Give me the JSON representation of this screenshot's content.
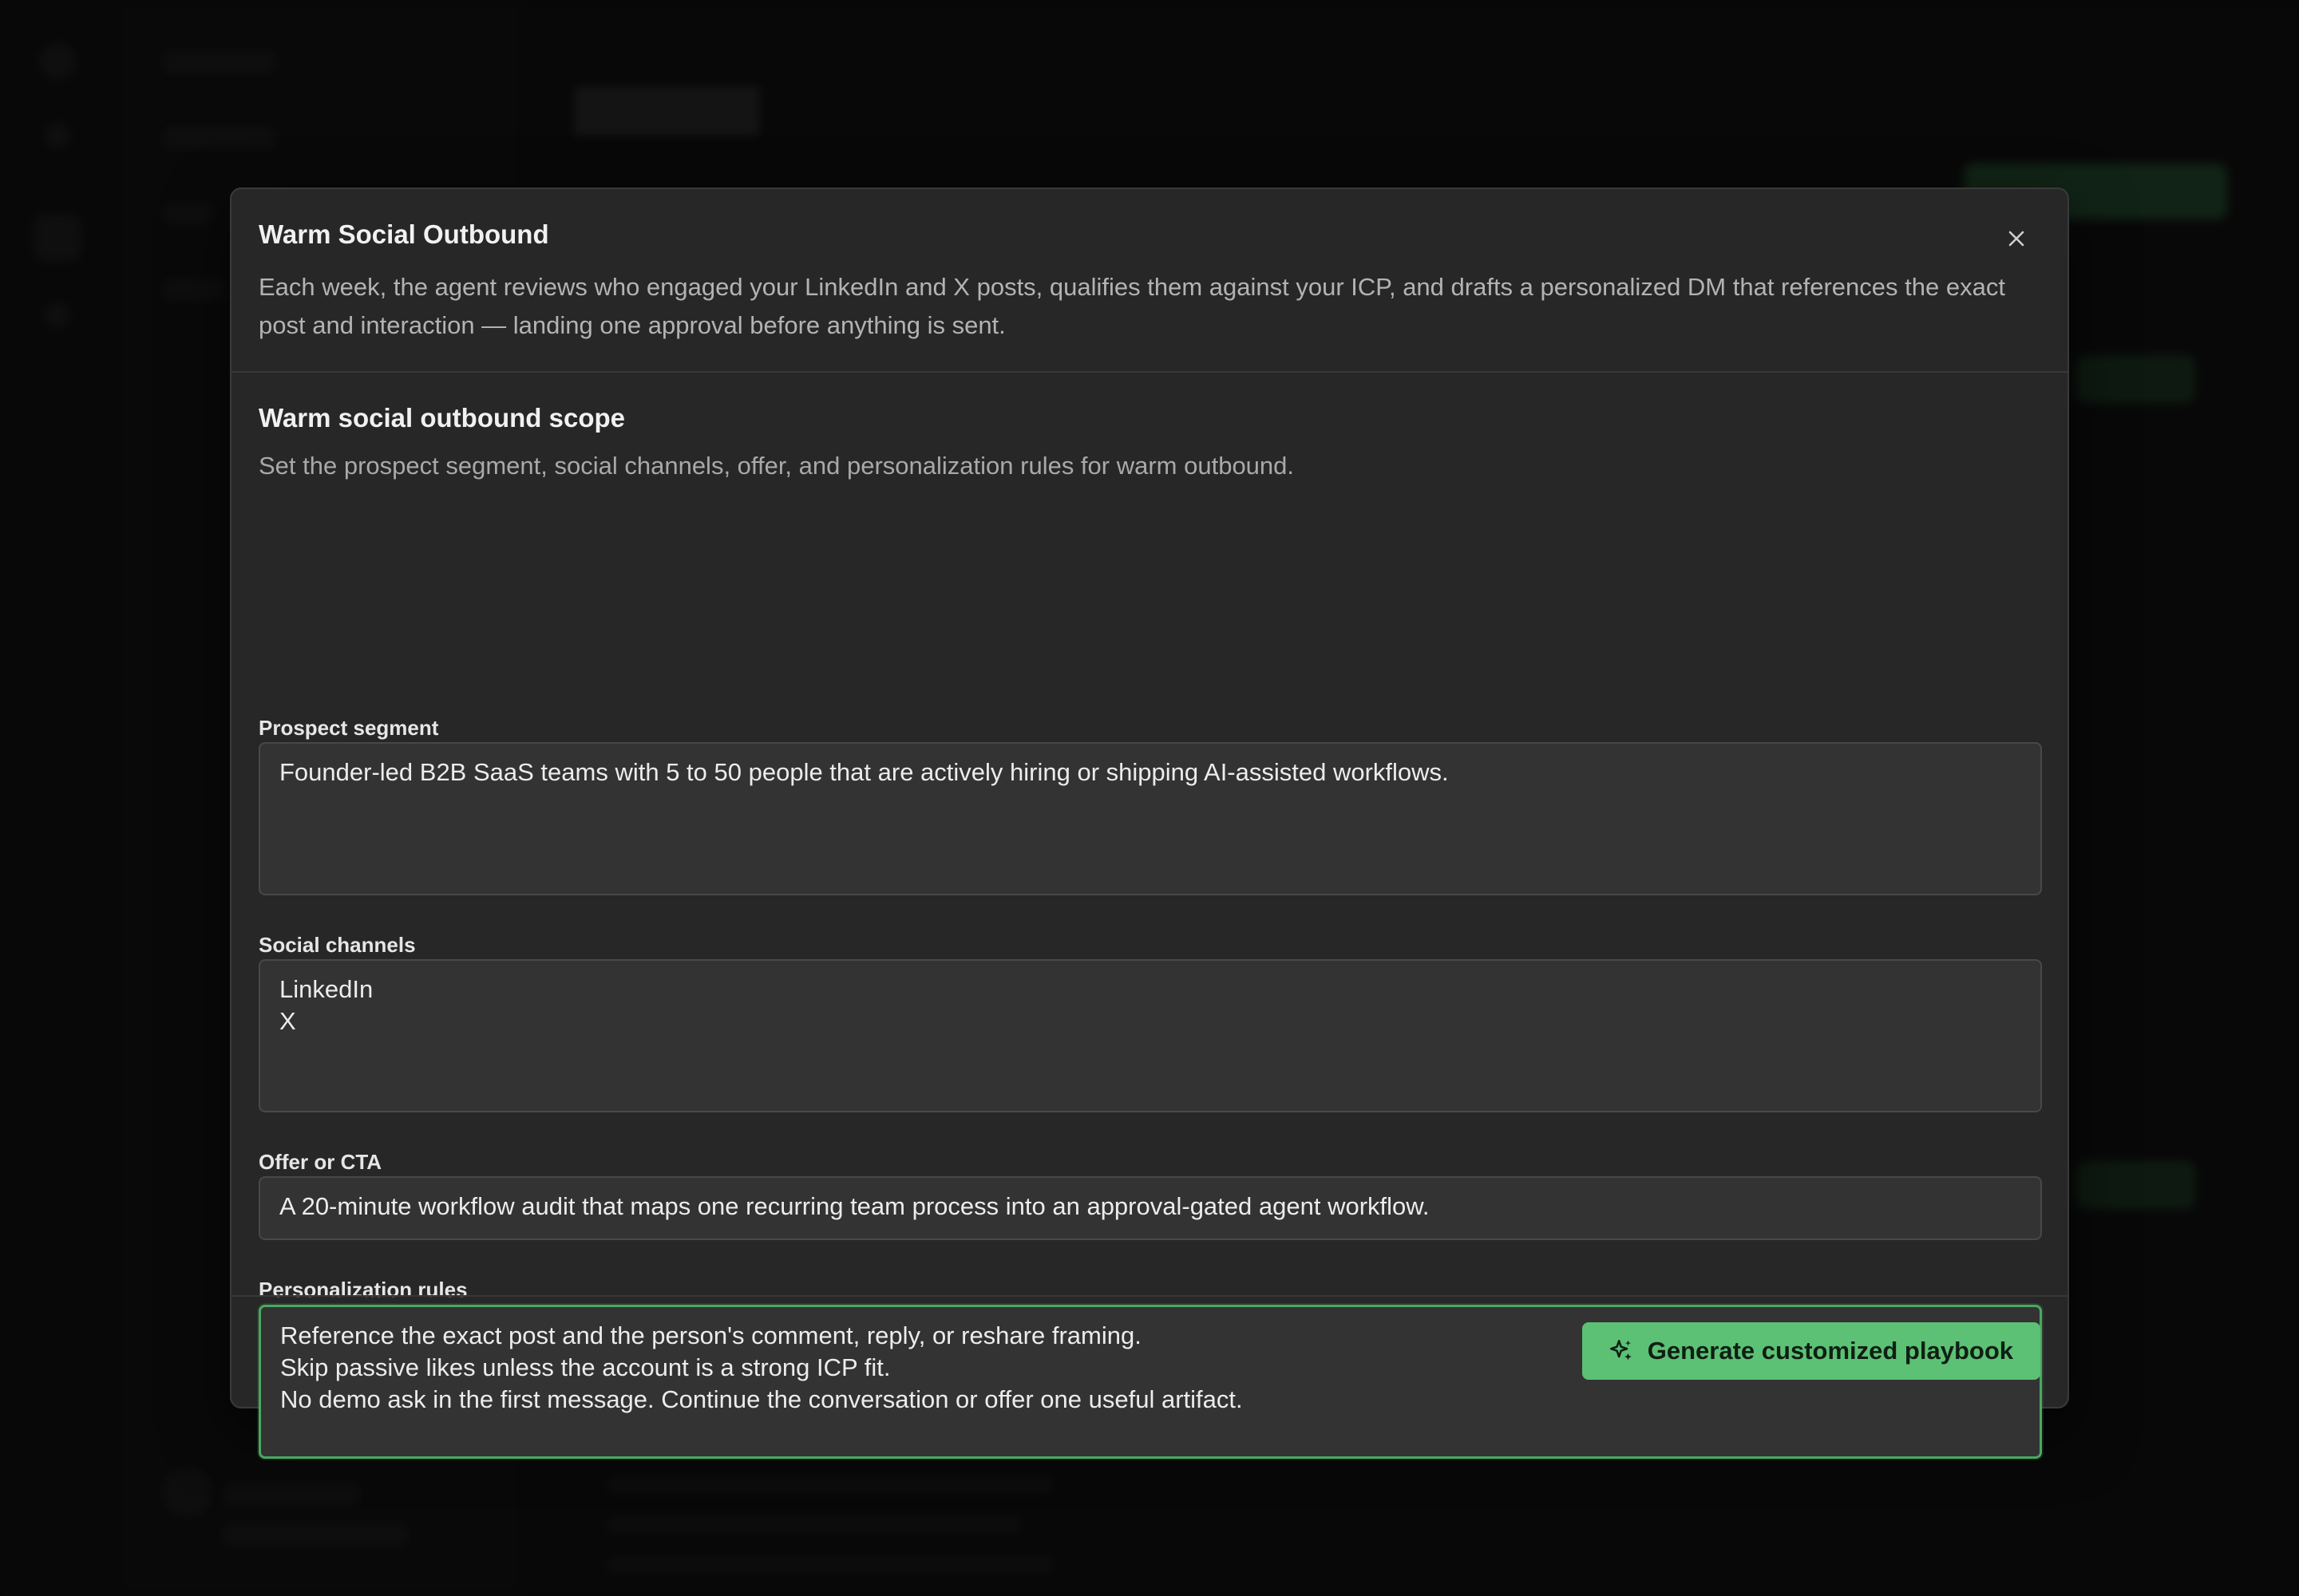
{
  "modal": {
    "title": "Warm Social Outbound",
    "description": "Each week, the agent reviews who engaged your LinkedIn and X posts, qualifies them against your ICP, and drafts a personalized DM that references the exact post and interaction — landing one approval before anything is sent.",
    "close_icon": "close-icon",
    "section": {
      "title": "Warm social outbound scope",
      "subtitle": "Set the prospect segment, social channels, offer, and personalization rules for warm outbound."
    },
    "fields": {
      "prospect_segment": {
        "label": "Prospect segment",
        "value": "Founder-led B2B SaaS teams with 5 to 50 people that are actively hiring or shipping AI-assisted workflows."
      },
      "social_channels": {
        "label": "Social channels",
        "value": "LinkedIn\nX"
      },
      "offer_cta": {
        "label": "Offer or CTA",
        "value": "A 20-minute workflow audit that maps one recurring team process into an approval-gated agent workflow."
      },
      "personalization_rules": {
        "label": "Personalization rules",
        "value": "Reference the exact post and the person's comment, reply, or reshare framing.\nSkip passive likes unless the account is a strong ICP fit.\nNo demo ask in the first message. Continue the conversation or offer one useful artifact."
      }
    },
    "footer": {
      "generate_label": "Generate customized playbook",
      "generate_icon": "sparkles-icon"
    }
  },
  "colors": {
    "accent": "#5cc175",
    "focus_ring": "#4aa862",
    "modal_bg": "#272727",
    "field_bg": "#333333"
  }
}
